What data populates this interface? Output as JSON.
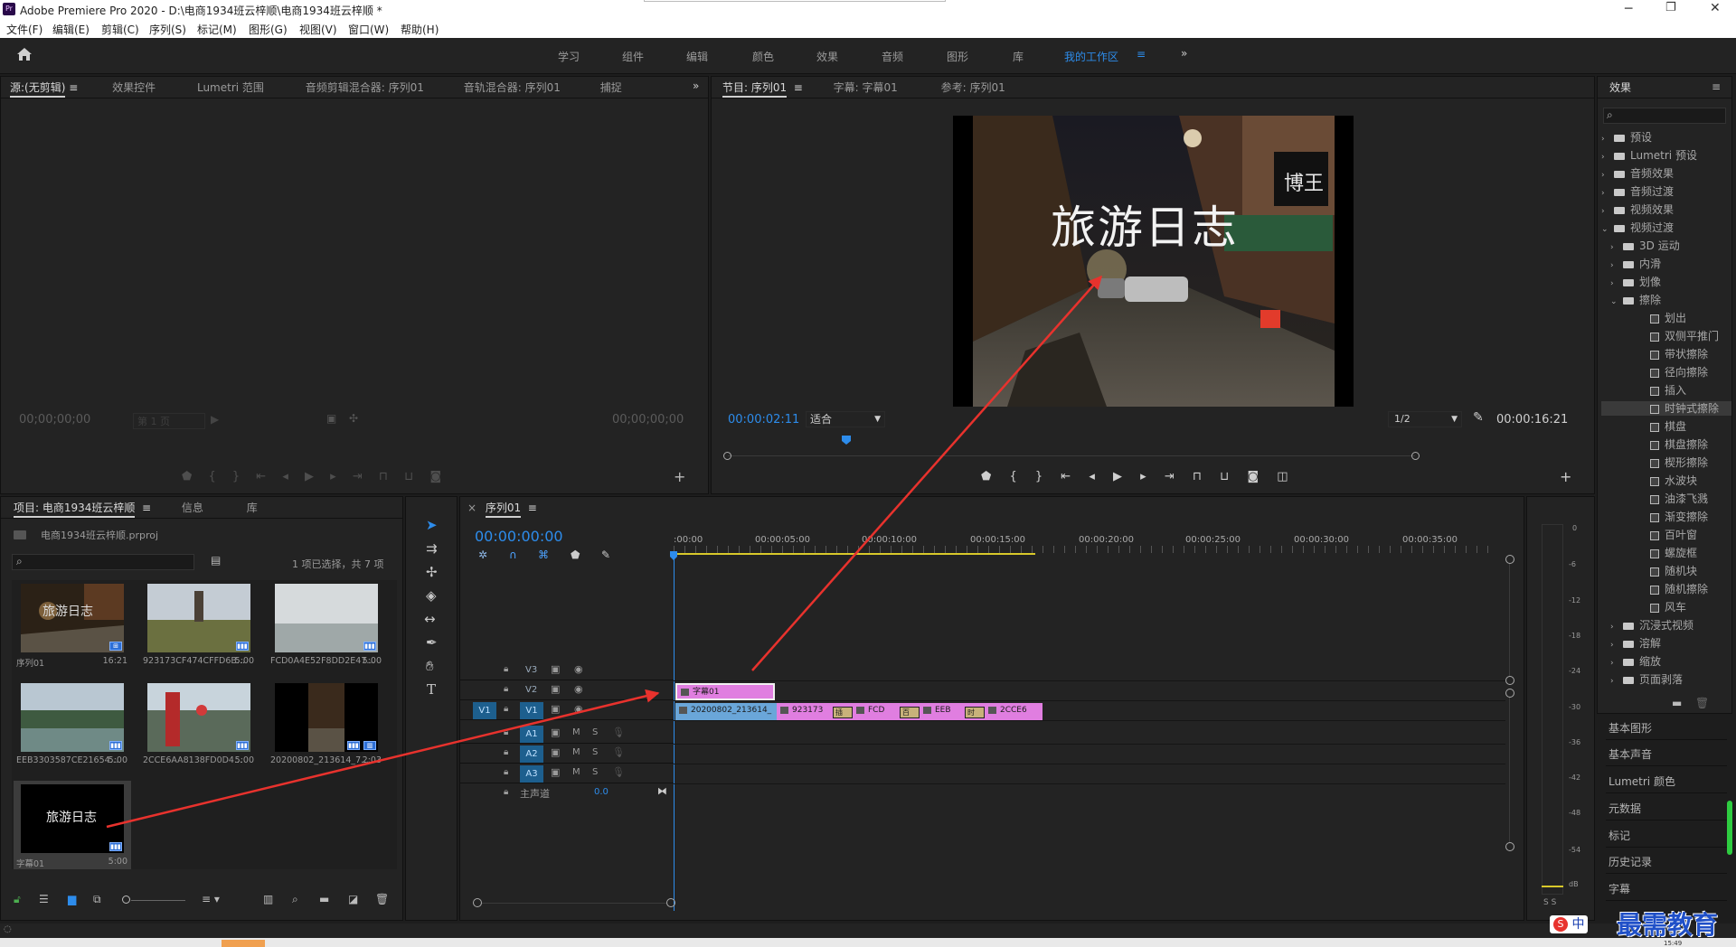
{
  "window": {
    "title": "Adobe Premiere Pro 2020 - D:\\电商1934班云梓顺\\电商1934班云梓顺 *",
    "app_icon": "Pr"
  },
  "menu": [
    "文件(F)",
    "编辑(E)",
    "剪辑(C)",
    "序列(S)",
    "标记(M)",
    "图形(G)",
    "视图(V)",
    "窗口(W)",
    "帮助(H)"
  ],
  "workspaces": [
    "学习",
    "组件",
    "编辑",
    "颜色",
    "效果",
    "音频",
    "图形",
    "库"
  ],
  "active_workspace": "我的工作区",
  "source_panel": {
    "tabs": [
      "源:(无剪辑)",
      "效果控件",
      "Lumetri 范围",
      "音频剪辑混合器: 序列01",
      "音轨混合器: 序列01",
      "捕捉"
    ],
    "timecode_left": "00;00;00;00",
    "page": "第 1 页",
    "timecode_right": "00;00;00;00"
  },
  "program_panel": {
    "tabs": [
      "节目: 序列01",
      "字幕: 字幕01",
      "参考: 序列01"
    ],
    "overlay_title": "旅游日志",
    "sign_text": "博王",
    "timecode": "00:00:02:11",
    "fit": "适合",
    "resolution": "1/2",
    "duration": "00:00:16:21"
  },
  "project_panel": {
    "tabs": [
      "项目: 电商1934班云梓顺",
      "信息",
      "库"
    ],
    "file": "电商1934班云梓顺.prproj",
    "selection": "1 项已选择，共 7 项",
    "items": [
      {
        "name": "序列01",
        "duration": "16:21",
        "overlay": "旅游日志"
      },
      {
        "name": "923173CF474CFFD6B...",
        "duration": "5:00"
      },
      {
        "name": "FCD0A4E52F8DD2E47...",
        "duration": "5:00"
      },
      {
        "name": "EEB3303587CE21654...",
        "duration": "5:00"
      },
      {
        "name": "2CCE6AA8138FD0D4...",
        "duration": "5:00"
      },
      {
        "name": "20200802_213614_7...",
        "duration": "2:03"
      },
      {
        "name": "字幕01",
        "duration": "5:00",
        "overlay": "旅游日志"
      }
    ]
  },
  "timeline": {
    "tab": "序列01",
    "timecode": "00:00:00:00",
    "ruler": [
      ":00:00",
      "00:00:05:00",
      "00:00:10:00",
      "00:00:15:00",
      "00:00:20:00",
      "00:00:25:00",
      "00:00:30:00",
      "00:00:35:00"
    ],
    "video_tracks": [
      "V3",
      "V2",
      "V1"
    ],
    "audio_tracks": [
      "A1",
      "A2",
      "A3"
    ],
    "master": "主声道",
    "master_value": "0.0",
    "track_buttons": {
      "mute": "M",
      "solo": "S"
    },
    "clips": {
      "title": "字幕01",
      "v1": [
        "20200802_213614_",
        "923173",
        "插",
        "FCD",
        "百",
        "EEB",
        "时",
        "2CCE6"
      ]
    }
  },
  "meter": {
    "scale": [
      "0",
      "-6",
      "-12",
      "-18",
      "-24",
      "-30",
      "-36",
      "-42",
      "-48",
      "-54",
      "dB"
    ],
    "solo": "S  S"
  },
  "effects_panel": {
    "title": "效果",
    "tree": [
      {
        "label": "预设",
        "level": 0,
        "type": "folder"
      },
      {
        "label": "Lumetri 预设",
        "level": 0,
        "type": "folder"
      },
      {
        "label": "音频效果",
        "level": 0,
        "type": "folder"
      },
      {
        "label": "音频过渡",
        "level": 0,
        "type": "folder"
      },
      {
        "label": "视频效果",
        "level": 0,
        "type": "folder"
      },
      {
        "label": "视频过渡",
        "level": 0,
        "type": "folder",
        "open": true
      },
      {
        "label": "3D 运动",
        "level": 1,
        "type": "folder"
      },
      {
        "label": "内滑",
        "level": 1,
        "type": "folder"
      },
      {
        "label": "划像",
        "level": 1,
        "type": "folder"
      },
      {
        "label": "擦除",
        "level": 1,
        "type": "folder",
        "open": true
      },
      {
        "label": "划出",
        "level": 2,
        "type": "fx"
      },
      {
        "label": "双侧平推门",
        "level": 2,
        "type": "fx"
      },
      {
        "label": "带状擦除",
        "level": 2,
        "type": "fx"
      },
      {
        "label": "径向擦除",
        "level": 2,
        "type": "fx"
      },
      {
        "label": "插入",
        "level": 2,
        "type": "fx"
      },
      {
        "label": "时钟式擦除",
        "level": 2,
        "type": "fx",
        "selected": true
      },
      {
        "label": "棋盘",
        "level": 2,
        "type": "fx"
      },
      {
        "label": "棋盘擦除",
        "level": 2,
        "type": "fx"
      },
      {
        "label": "楔形擦除",
        "level": 2,
        "type": "fx"
      },
      {
        "label": "水波块",
        "level": 2,
        "type": "fx"
      },
      {
        "label": "油漆飞溅",
        "level": 2,
        "type": "fx"
      },
      {
        "label": "渐变擦除",
        "level": 2,
        "type": "fx"
      },
      {
        "label": "百叶窗",
        "level": 2,
        "type": "fx"
      },
      {
        "label": "螺旋框",
        "level": 2,
        "type": "fx"
      },
      {
        "label": "随机块",
        "level": 2,
        "type": "fx"
      },
      {
        "label": "随机擦除",
        "level": 2,
        "type": "fx"
      },
      {
        "label": "风车",
        "level": 2,
        "type": "fx"
      },
      {
        "label": "沉浸式视频",
        "level": 1,
        "type": "folder"
      },
      {
        "label": "溶解",
        "level": 1,
        "type": "folder"
      },
      {
        "label": "缩放",
        "level": 1,
        "type": "folder"
      },
      {
        "label": "页面剥落",
        "level": 1,
        "type": "folder"
      }
    ],
    "panels": [
      "基本图形",
      "基本声音",
      "Lumetri 颜色",
      "元数据",
      "标记",
      "历史记录",
      "字幕"
    ]
  },
  "watermark": "最需教育",
  "taskbar": {
    "ime": "中",
    "time": "15:49"
  },
  "colors": {
    "accent": "#2d8ceb",
    "clip_pink": "#e07ee0",
    "clip_blue": "#6aa6d9",
    "arrow": "#e8322d"
  }
}
